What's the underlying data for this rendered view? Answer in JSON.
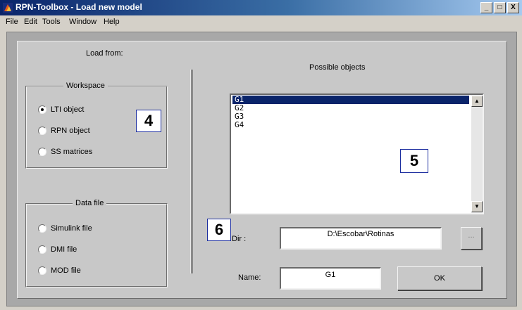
{
  "window": {
    "title": "RPN-Toolbox - Load new model",
    "controls": [
      "_",
      "□",
      "X"
    ]
  },
  "menu": [
    "File",
    "Edit",
    "Tools",
    "Window",
    "Help"
  ],
  "left": {
    "load_from": "Load from:",
    "workspace": {
      "title": "Workspace",
      "options": [
        {
          "label": "LTI object",
          "selected": true
        },
        {
          "label": "RPN object",
          "selected": false
        },
        {
          "label": "SS matrices",
          "selected": false
        }
      ]
    },
    "datafile": {
      "title": "Data file",
      "options": [
        {
          "label": "Simulink file",
          "selected": false
        },
        {
          "label": "DMI file",
          "selected": false
        },
        {
          "label": "MOD file",
          "selected": false
        }
      ]
    }
  },
  "right": {
    "possible_objects": "Possible objects",
    "objects": [
      "G1",
      "G2",
      "G3",
      "G4"
    ],
    "selected_object": "G1",
    "dir_label": "Dir :",
    "dir_value": "D:\\Escobar\\Rotinas",
    "browse_label": "...",
    "name_label": "Name:",
    "name_value": "G1",
    "ok_label": "OK"
  },
  "annotations": [
    "4",
    "5",
    "6"
  ],
  "colors": {
    "title_bar": "#0a246a",
    "selection": "#0a246a",
    "annotation_border": "#1d2fa0"
  }
}
